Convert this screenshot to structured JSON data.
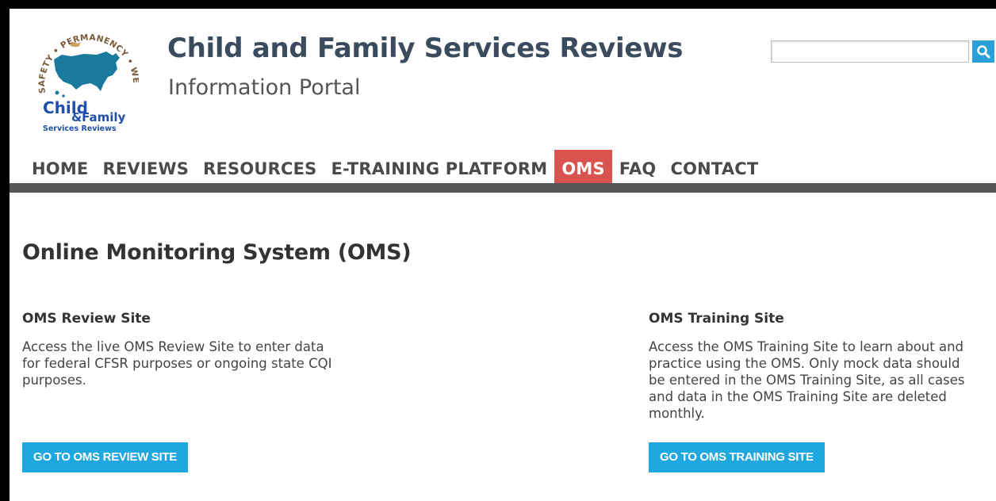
{
  "header": {
    "logo_text": {
      "ring": "SAFETY • PERMANENCY • WELL-BEING",
      "line1": "Child",
      "line2": "&Family",
      "line3": "Services Reviews"
    },
    "title": "Child and Family Services Reviews",
    "subtitle": "Information Portal",
    "search": {
      "value": "",
      "placeholder": "",
      "icon": "search-icon"
    }
  },
  "nav": {
    "items": [
      {
        "label": "HOME"
      },
      {
        "label": "REVIEWS"
      },
      {
        "label": "RESOURCES"
      },
      {
        "label": "E-TRAINING PLATFORM"
      },
      {
        "label": "OMS",
        "active": true
      },
      {
        "label": "FAQ"
      },
      {
        "label": "CONTACT"
      }
    ]
  },
  "main": {
    "heading": "Online Monitoring System (OMS)",
    "sections": [
      {
        "title": "OMS Review Site",
        "body": "Access the live OMS Review Site to enter data for federal CFSR purposes or ongoing state CQI purposes.",
        "button": "GO TO OMS REVIEW SITE"
      },
      {
        "title": "OMS Training Site",
        "body": "Access the OMS Training Site to learn about and practice using the OMS. Only mock data should be entered in the OMS Training Site, as all cases and data in the OMS Training Site are deleted monthly.",
        "button": "GO TO OMS TRAINING SITE"
      }
    ]
  },
  "colors": {
    "title": "#3b4b5e",
    "nav_active": "#d9534f",
    "nav_bar": "#555555",
    "button": "#1fa7e0",
    "logo_map": "#1a7a9e",
    "logo_ring": "#7a5a3a",
    "logo_text": "#1f4fa8"
  }
}
